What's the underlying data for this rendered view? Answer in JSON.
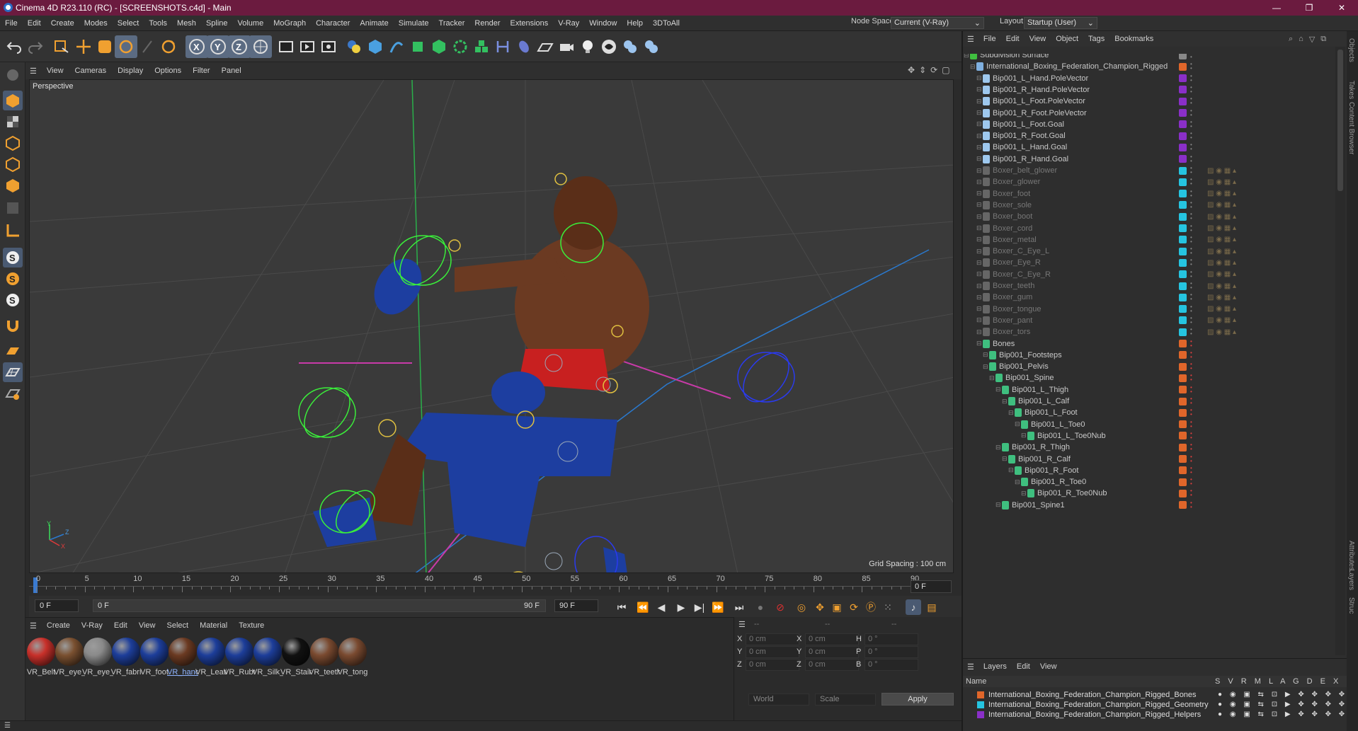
{
  "window": {
    "title": "Cinema 4D R23.110 (RC) - [SCREENSHOTS.c4d] - Main",
    "minimize": "—",
    "maximize": "❐",
    "close": "✕"
  },
  "menu": [
    "File",
    "Edit",
    "Create",
    "Modes",
    "Select",
    "Tools",
    "Mesh",
    "Spline",
    "Volume",
    "MoGraph",
    "Character",
    "Animate",
    "Simulate",
    "Tracker",
    "Render",
    "Extensions",
    "V-Ray",
    "Window",
    "Help",
    "3DToAll"
  ],
  "nodespace": {
    "label": "Node Space:",
    "value": "Current (V-Ray)"
  },
  "layout": {
    "label": "Layout:",
    "value": "Startup (User)"
  },
  "viewport": {
    "menu": [
      "View",
      "Cameras",
      "Display",
      "Options",
      "Filter",
      "Panel"
    ],
    "label": "Perspective",
    "grid_spacing": "Grid Spacing : 100 cm",
    "axis": {
      "x": "X",
      "y": "Y",
      "z": "Z"
    }
  },
  "timeline": {
    "ticks": [
      "0",
      "5",
      "10",
      "15",
      "20",
      "25",
      "30",
      "35",
      "40",
      "45",
      "50",
      "55",
      "60",
      "65",
      "70",
      "75",
      "80",
      "85",
      "90"
    ],
    "current": "0 F"
  },
  "transport": {
    "start": "0 F",
    "range_start": "0 F",
    "range_end": "90 F",
    "end": "90 F"
  },
  "materials": {
    "menu": [
      "Create",
      "V-Ray",
      "Edit",
      "View",
      "Select",
      "Material",
      "Texture"
    ],
    "items": [
      {
        "label": "VR_Belt",
        "color": "#c8302a"
      },
      {
        "label": "VR_eye_",
        "color": "#7a5030"
      },
      {
        "label": "VR_eye_",
        "color": "#8a8a8a"
      },
      {
        "label": "VR_fabri",
        "color": "#1d3e9a"
      },
      {
        "label": "VR_foot",
        "color": "#1d3e9a"
      },
      {
        "label": "VR_hand",
        "color": "#6b3a22"
      },
      {
        "label": "VR_Leatl",
        "color": "#1d3e9a"
      },
      {
        "label": "VR_Rubt",
        "color": "#1d3e9a"
      },
      {
        "label": "VR_Silk_",
        "color": "#1d3e9a"
      },
      {
        "label": "VR_Stain",
        "color": "#111111"
      },
      {
        "label": "VR_teeth",
        "color": "#7a4a30"
      },
      {
        "label": "VR_tong",
        "color": "#7a4a30"
      }
    ]
  },
  "coords": {
    "header": [
      "--",
      "--",
      "--"
    ],
    "rows": [
      {
        "a": "X",
        "av": "0 cm",
        "b": "X",
        "bv": "0 cm",
        "c": "H",
        "cv": "0 °"
      },
      {
        "a": "Y",
        "av": "0 cm",
        "b": "Y",
        "bv": "0 cm",
        "c": "P",
        "cv": "0 °"
      },
      {
        "a": "Z",
        "av": "0 cm",
        "b": "Z",
        "bv": "0 cm",
        "c": "B",
        "cv": "0 °"
      }
    ],
    "world": "World",
    "scale": "Scale",
    "apply": "Apply"
  },
  "objects": {
    "menu": [
      "File",
      "Edit",
      "View",
      "Object",
      "Tags",
      "Bookmarks"
    ],
    "rows": [
      {
        "name": "Subdivision Surface",
        "indent": 0,
        "dim": false,
        "tag": "#888888",
        "ico": "#3fbf3f"
      },
      {
        "name": "International_Boxing_Federation_Champion_Rigged",
        "indent": 1,
        "dim": false,
        "tag": "#e0662a",
        "ico": "#7fb0e0"
      },
      {
        "name": "Bip001_L_Hand.PoleVector",
        "indent": 2,
        "dim": false,
        "tag": "#8a2fc8",
        "ico": "#9ec8ee"
      },
      {
        "name": "Bip001_R_Hand.PoleVector",
        "indent": 2,
        "dim": false,
        "tag": "#8a2fc8",
        "ico": "#9ec8ee"
      },
      {
        "name": "Bip001_L_Foot.PoleVector",
        "indent": 2,
        "dim": false,
        "tag": "#8a2fc8",
        "ico": "#9ec8ee"
      },
      {
        "name": "Bip001_R_Foot.PoleVector",
        "indent": 2,
        "dim": false,
        "tag": "#8a2fc8",
        "ico": "#9ec8ee"
      },
      {
        "name": "Bip001_L_Foot.Goal",
        "indent": 2,
        "dim": false,
        "tag": "#8a2fc8",
        "ico": "#9ec8ee"
      },
      {
        "name": "Bip001_R_Foot.Goal",
        "indent": 2,
        "dim": false,
        "tag": "#8a2fc8",
        "ico": "#9ec8ee"
      },
      {
        "name": "Bip001_L_Hand.Goal",
        "indent": 2,
        "dim": false,
        "tag": "#8a2fc8",
        "ico": "#9ec8ee"
      },
      {
        "name": "Bip001_R_Hand.Goal",
        "indent": 2,
        "dim": false,
        "tag": "#8a2fc8",
        "ico": "#9ec8ee"
      },
      {
        "name": "Boxer_belt_glower",
        "indent": 2,
        "dim": true,
        "tag": "#25c4e0",
        "ico": "#666666"
      },
      {
        "name": "Boxer_glower",
        "indent": 2,
        "dim": true,
        "tag": "#25c4e0",
        "ico": "#666666"
      },
      {
        "name": "Boxer_foot",
        "indent": 2,
        "dim": true,
        "tag": "#25c4e0",
        "ico": "#666666"
      },
      {
        "name": "Boxer_sole",
        "indent": 2,
        "dim": true,
        "tag": "#25c4e0",
        "ico": "#666666"
      },
      {
        "name": "Boxer_boot",
        "indent": 2,
        "dim": true,
        "tag": "#25c4e0",
        "ico": "#666666"
      },
      {
        "name": "Boxer_cord",
        "indent": 2,
        "dim": true,
        "tag": "#25c4e0",
        "ico": "#666666"
      },
      {
        "name": "Boxer_metal",
        "indent": 2,
        "dim": true,
        "tag": "#25c4e0",
        "ico": "#666666"
      },
      {
        "name": "Boxer_C_Eye_L",
        "indent": 2,
        "dim": true,
        "tag": "#25c4e0",
        "ico": "#666666"
      },
      {
        "name": "Boxer_Eye_R",
        "indent": 2,
        "dim": true,
        "tag": "#25c4e0",
        "ico": "#666666"
      },
      {
        "name": "Boxer_C_Eye_R",
        "indent": 2,
        "dim": true,
        "tag": "#25c4e0",
        "ico": "#666666"
      },
      {
        "name": "Boxer_teeth",
        "indent": 2,
        "dim": true,
        "tag": "#25c4e0",
        "ico": "#666666"
      },
      {
        "name": "Boxer_gum",
        "indent": 2,
        "dim": true,
        "tag": "#25c4e0",
        "ico": "#666666"
      },
      {
        "name": "Boxer_tongue",
        "indent": 2,
        "dim": true,
        "tag": "#25c4e0",
        "ico": "#666666"
      },
      {
        "name": "Boxer_pant",
        "indent": 2,
        "dim": true,
        "tag": "#25c4e0",
        "ico": "#666666"
      },
      {
        "name": "Boxer_tors",
        "indent": 2,
        "dim": true,
        "tag": "#25c4e0",
        "ico": "#666666"
      },
      {
        "name": "Bones",
        "indent": 2,
        "dim": false,
        "tag": "#e0662a",
        "ico": "#3fbf7f"
      },
      {
        "name": "Bip001_Footsteps",
        "indent": 3,
        "dim": false,
        "tag": "#e0662a",
        "ico": "#3fbf7f"
      },
      {
        "name": "Bip001_Pelvis",
        "indent": 3,
        "dim": false,
        "tag": "#e0662a",
        "ico": "#3fbf7f"
      },
      {
        "name": "Bip001_Spine",
        "indent": 4,
        "dim": false,
        "tag": "#e0662a",
        "ico": "#3fbf7f"
      },
      {
        "name": "Bip001_L_Thigh",
        "indent": 5,
        "dim": false,
        "tag": "#e0662a",
        "ico": "#3fbf7f"
      },
      {
        "name": "Bip001_L_Calf",
        "indent": 6,
        "dim": false,
        "tag": "#e0662a",
        "ico": "#3fbf7f"
      },
      {
        "name": "Bip001_L_Foot",
        "indent": 7,
        "dim": false,
        "tag": "#e0662a",
        "ico": "#3fbf7f"
      },
      {
        "name": "Bip001_L_Toe0",
        "indent": 8,
        "dim": false,
        "tag": "#e0662a",
        "ico": "#3fbf7f"
      },
      {
        "name": "Bip001_L_Toe0Nub",
        "indent": 9,
        "dim": false,
        "tag": "#e0662a",
        "ico": "#3fbf7f"
      },
      {
        "name": "Bip001_R_Thigh",
        "indent": 5,
        "dim": false,
        "tag": "#e0662a",
        "ico": "#3fbf7f"
      },
      {
        "name": "Bip001_R_Calf",
        "indent": 6,
        "dim": false,
        "tag": "#e0662a",
        "ico": "#3fbf7f"
      },
      {
        "name": "Bip001_R_Foot",
        "indent": 7,
        "dim": false,
        "tag": "#e0662a",
        "ico": "#3fbf7f"
      },
      {
        "name": "Bip001_R_Toe0",
        "indent": 8,
        "dim": false,
        "tag": "#e0662a",
        "ico": "#3fbf7f"
      },
      {
        "name": "Bip001_R_Toe0Nub",
        "indent": 9,
        "dim": false,
        "tag": "#e0662a",
        "ico": "#3fbf7f"
      },
      {
        "name": "Bip001_Spine1",
        "indent": 5,
        "dim": false,
        "tag": "#e0662a",
        "ico": "#3fbf7f"
      }
    ]
  },
  "layers": {
    "menu": [
      "Layers",
      "Edit",
      "View"
    ],
    "header": {
      "name": "Name",
      "cols": "S V R M L A G D E X"
    },
    "rows": [
      {
        "name": "International_Boxing_Federation_Champion_Rigged_Bones",
        "color": "#e0662a"
      },
      {
        "name": "International_Boxing_Federation_Champion_Rigged_Geometry",
        "color": "#25c4e0"
      },
      {
        "name": "International_Boxing_Federation_Champion_Rigged_Helpers",
        "color": "#8a2fc8"
      }
    ]
  },
  "side_tabs": [
    "Objects",
    "Takes",
    "Content Browser",
    "Attributes",
    "Layers",
    "Struc"
  ]
}
